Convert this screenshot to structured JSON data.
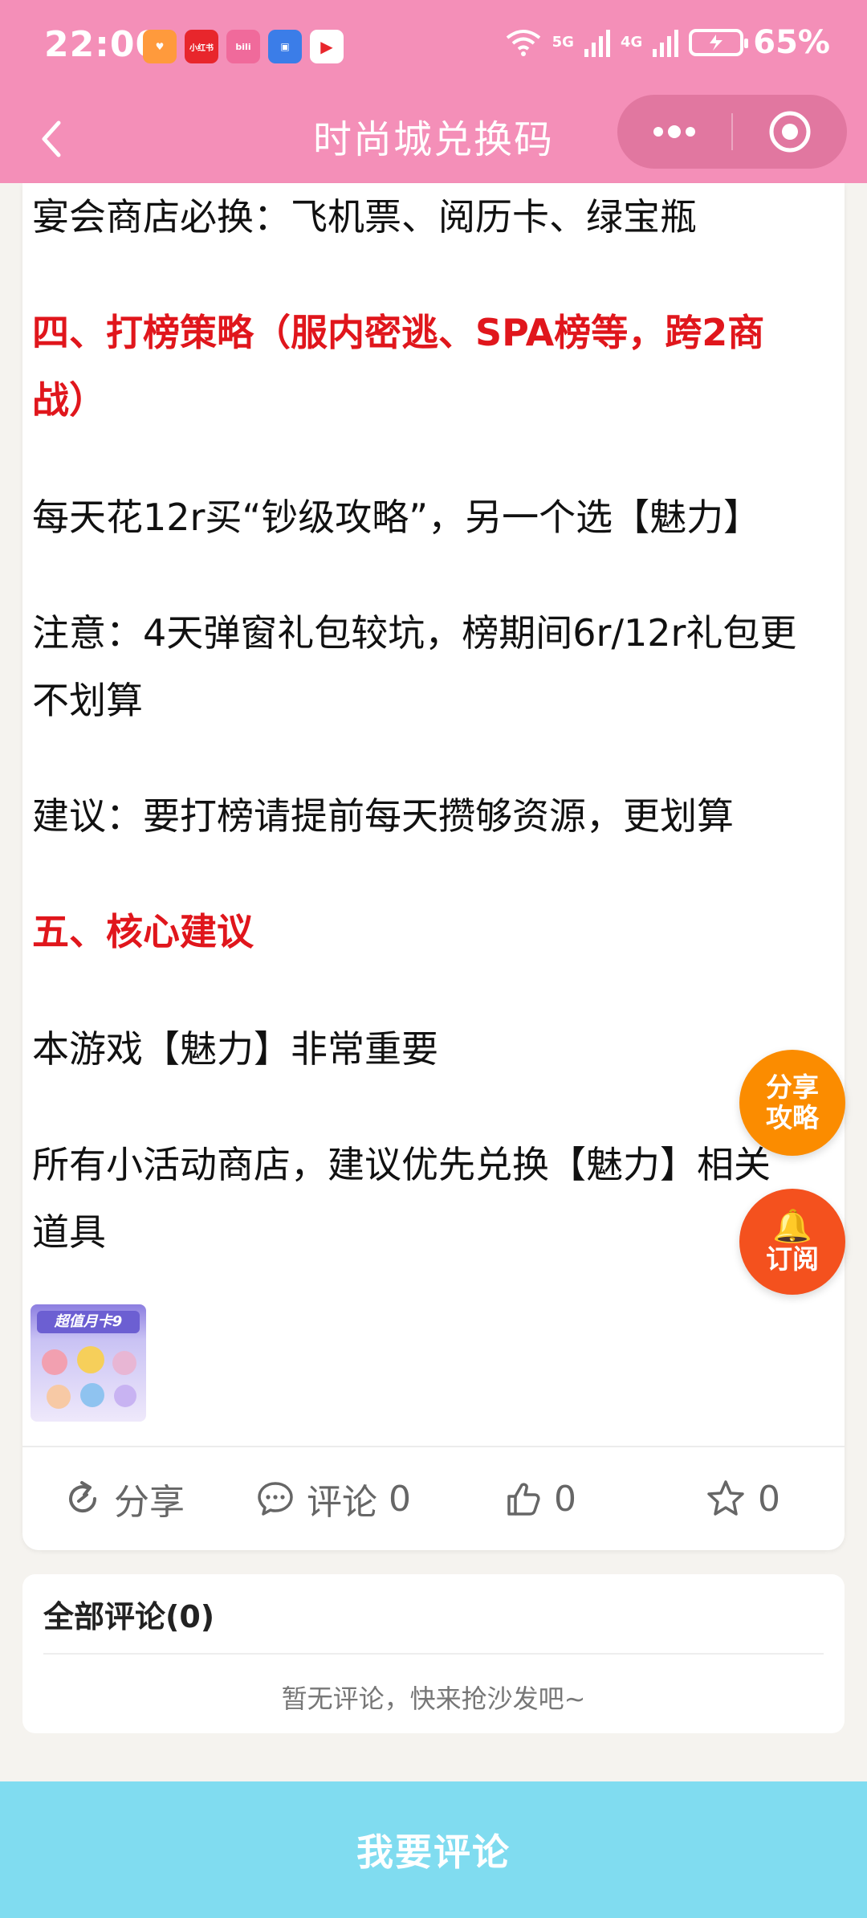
{
  "status_bar": {
    "time": "22:00",
    "signal_1": "5G",
    "signal_2": "4G",
    "battery": "65%",
    "app_icons": [
      {
        "name": "heart-app",
        "color": "#ff9a3c",
        "label": "♥"
      },
      {
        "name": "xiaohongshu-app",
        "color": "#e8262c",
        "label": "小红书"
      },
      {
        "name": "bilibili-app",
        "color": "#f06a9b",
        "label": "bili"
      },
      {
        "name": "blue-app",
        "color": "#3b7de8",
        "label": "▣"
      },
      {
        "name": "play-app",
        "color": "#ffffff",
        "label": "▶"
      }
    ]
  },
  "header": {
    "title": "时尚城兑换码",
    "accent_color": "#f48fb8"
  },
  "article": {
    "paragraphs": [
      {
        "text": "宴会商店必换：飞机票、阅历卡、绿宝瓶",
        "heading": false
      },
      {
        "text": "四、打榜策略（服内密逃、SPA榜等，跨2商",
        "heading": true
      },
      {
        "text": "战）",
        "heading": true
      },
      {
        "text": "每天花12r买“钞级攻略”，另一个选【魅力】",
        "heading": false
      },
      {
        "text": "注意：4天弹窗礼包较坑，榜期间6r/12r礼包更",
        "heading": false
      },
      {
        "text": "不划算",
        "heading": false
      },
      {
        "text": "建议：要打榜请提前每天攒够资源，更划算",
        "heading": false
      },
      {
        "text": "五、核心建议",
        "heading": true
      },
      {
        "text": "本游戏【魅力】非常重要",
        "heading": false
      },
      {
        "text": "所有小活动商店，建议优先兑换【魅力】相关",
        "heading": false
      },
      {
        "text": "道具",
        "heading": false
      }
    ],
    "thumbnail_caption": "超值月卡9"
  },
  "actions": {
    "share_label": "分享",
    "comment_label": "评论",
    "comment_count": "0",
    "like_count": "0",
    "fav_count": "0"
  },
  "comments": {
    "title": "全部评论(0)",
    "empty_text": "暂无评论，快来抢沙发吧~"
  },
  "floating": {
    "share_line1": "分享",
    "share_line2": "攻略",
    "subscribe_icon": "🔔",
    "subscribe_label": "订阅"
  },
  "bottom_bar": {
    "label": "我要评论",
    "color": "#80dcf0"
  }
}
